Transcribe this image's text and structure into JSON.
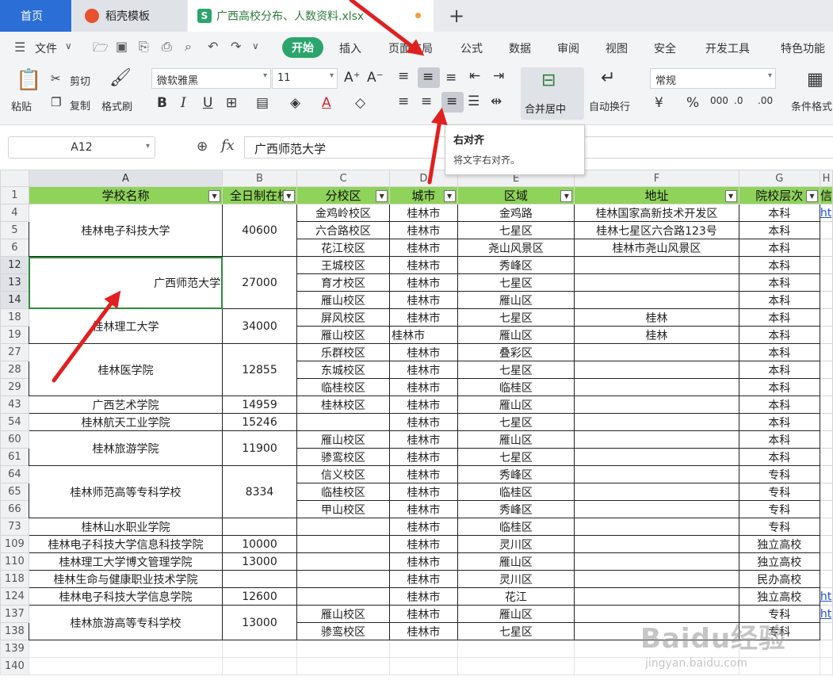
{
  "tabs": {
    "home": "首页",
    "template": "稻壳模板",
    "file": "广西高校分布、人数资料.xlsx",
    "new_tab": "+"
  },
  "menu": {
    "file": "文件",
    "items": [
      "开始",
      "插入",
      "页面布局",
      "公式",
      "数据",
      "审阅",
      "视图",
      "安全",
      "开发工具",
      "特色功能"
    ]
  },
  "ribbon": {
    "paste": "粘贴",
    "cut": "剪切",
    "copy": "复制",
    "format_painter": "格式刷",
    "font_name": "微软雅黑",
    "font_size": "11",
    "merge_center": "合并居中",
    "wrap_text": "自动换行",
    "number_format": "常规",
    "conditional_format": "条件格式"
  },
  "tooltip": {
    "title": "右对齐",
    "desc": "将文字右对齐。"
  },
  "formula": {
    "cell_ref": "A12",
    "fx": "fx",
    "value": "广西师范大学"
  },
  "colors": {
    "header_green": "#8fd35a",
    "start_tab": "#2aa56b",
    "home_tab": "#2b6fd6",
    "selection": "#2e8b3a",
    "arrow": "#e02020"
  },
  "sheet": {
    "columns": [
      "A",
      "B",
      "C",
      "D",
      "E",
      "F",
      "G",
      "H"
    ],
    "headers": [
      "学校名称",
      "全日制在校",
      "分校区",
      "城市",
      "区域",
      "地址",
      "院校层次",
      "信"
    ],
    "row_numbers": [
      "4",
      "5",
      "6",
      "12",
      "13",
      "14",
      "18",
      "19",
      "27",
      "28",
      "29",
      "43",
      "54",
      "60",
      "61",
      "64",
      "65",
      "66",
      "73",
      "109",
      "110",
      "118",
      "124",
      "137",
      "138",
      "139",
      "140"
    ],
    "schools": [
      {
        "name": "桂林电子科技大学",
        "students": "40600"
      },
      {
        "name": "广西师范大学",
        "students": "27000"
      },
      {
        "name": "桂林理工大学",
        "students": "34000"
      },
      {
        "name": "桂林医学院",
        "students": "12855"
      },
      {
        "name": "广西艺术学院",
        "students": "14959"
      },
      {
        "name": "桂林航天工业学院",
        "students": "15246"
      },
      {
        "name": "桂林旅游学院",
        "students": "11900"
      },
      {
        "name": "桂林师范高等专科学校",
        "students": "8334"
      },
      {
        "name": "桂林山水职业学院",
        "students": ""
      },
      {
        "name": "桂林电子科技大学信息科技学院",
        "students": "10000"
      },
      {
        "name": "桂林理工大学博文管理学院",
        "students": "13000"
      },
      {
        "name": "桂林生命与健康职业技术学院",
        "students": ""
      },
      {
        "name": "桂林电子科技大学信息学院",
        "students": "12600"
      },
      {
        "name": "桂林旅游高等专科学校",
        "students": "13000"
      }
    ],
    "rows": [
      {
        "campus": "金鸡岭校区",
        "city": "桂林市",
        "area": "金鸡路",
        "addr": "桂林国家高新技术开发区",
        "level": "本科",
        "extra": "ht"
      },
      {
        "campus": "六合路校区",
        "city": "桂林市",
        "area": "七星区",
        "addr": "桂林七星区六合路123号",
        "level": "本科",
        "extra": ""
      },
      {
        "campus": "花江校区",
        "city": "桂林市",
        "area": "尧山风景区",
        "addr": "桂林市尧山风景区",
        "level": "本科",
        "extra": ""
      },
      {
        "campus": "王城校区",
        "city": "桂林市",
        "area": "秀峰区",
        "addr": "",
        "level": "本科",
        "extra": ""
      },
      {
        "campus": "育才校区",
        "city": "桂林市",
        "area": "七星区",
        "addr": "",
        "level": "本科",
        "extra": ""
      },
      {
        "campus": "雁山校区",
        "city": "桂林市",
        "area": "雁山区",
        "addr": "",
        "level": "本科",
        "extra": ""
      },
      {
        "campus": "屏风校区",
        "city": "桂林市",
        "area": "七星区",
        "addr": "桂林",
        "level": "本科",
        "extra": ""
      },
      {
        "campus": "雁山校区",
        "city": "桂林市",
        "area": "雁山区",
        "addr": "桂林",
        "level": "本科",
        "extra": ""
      },
      {
        "campus": "乐群校区",
        "city": "桂林市",
        "area": "叠彩区",
        "addr": "",
        "level": "本科",
        "extra": ""
      },
      {
        "campus": "东城校区",
        "city": "桂林市",
        "area": "七星区",
        "addr": "",
        "level": "本科",
        "extra": ""
      },
      {
        "campus": "临桂校区",
        "city": "桂林市",
        "area": "临桂区",
        "addr": "",
        "level": "本科",
        "extra": ""
      },
      {
        "campus": "桂林校区",
        "city": "桂林市",
        "area": "雁山区",
        "addr": "",
        "level": "本科",
        "extra": ""
      },
      {
        "campus": "",
        "city": "桂林市",
        "area": "七星区",
        "addr": "",
        "level": "本科",
        "extra": ""
      },
      {
        "campus": "雁山校区",
        "city": "桂林市",
        "area": "雁山区",
        "addr": "",
        "level": "本科",
        "extra": ""
      },
      {
        "campus": "骖鸾校区",
        "city": "桂林市",
        "area": "七星区",
        "addr": "",
        "level": "本科",
        "extra": ""
      },
      {
        "campus": "信义校区",
        "city": "桂林市",
        "area": "秀峰区",
        "addr": "",
        "level": "专科",
        "extra": ""
      },
      {
        "campus": "临桂校区",
        "city": "桂林市",
        "area": "临桂区",
        "addr": "",
        "level": "专科",
        "extra": ""
      },
      {
        "campus": "甲山校区",
        "city": "桂林市",
        "area": "秀峰区",
        "addr": "",
        "level": "专科",
        "extra": ""
      },
      {
        "campus": "",
        "city": "桂林市",
        "area": "临桂区",
        "addr": "",
        "level": "专科",
        "extra": ""
      },
      {
        "campus": "",
        "city": "桂林市",
        "area": "灵川区",
        "addr": "",
        "level": "独立高校",
        "extra": ""
      },
      {
        "campus": "",
        "city": "桂林市",
        "area": "雁山区",
        "addr": "",
        "level": "独立高校",
        "extra": ""
      },
      {
        "campus": "",
        "city": "桂林市",
        "area": "灵川区",
        "addr": "",
        "level": "民办高校",
        "extra": ""
      },
      {
        "campus": "",
        "city": "桂林市",
        "area": "花江",
        "addr": "",
        "level": "独立高校",
        "extra": "ht"
      },
      {
        "campus": "雁山校区",
        "city": "桂林市",
        "area": "雁山区",
        "addr": "",
        "level": "专科",
        "extra": "ht"
      },
      {
        "campus": "骖鸾校区",
        "city": "桂林市",
        "area": "七星区",
        "addr": "",
        "level": "专科",
        "extra": ""
      }
    ]
  },
  "watermark": {
    "brand": "Baidu经验",
    "url": "jingyan.baidu.com"
  }
}
